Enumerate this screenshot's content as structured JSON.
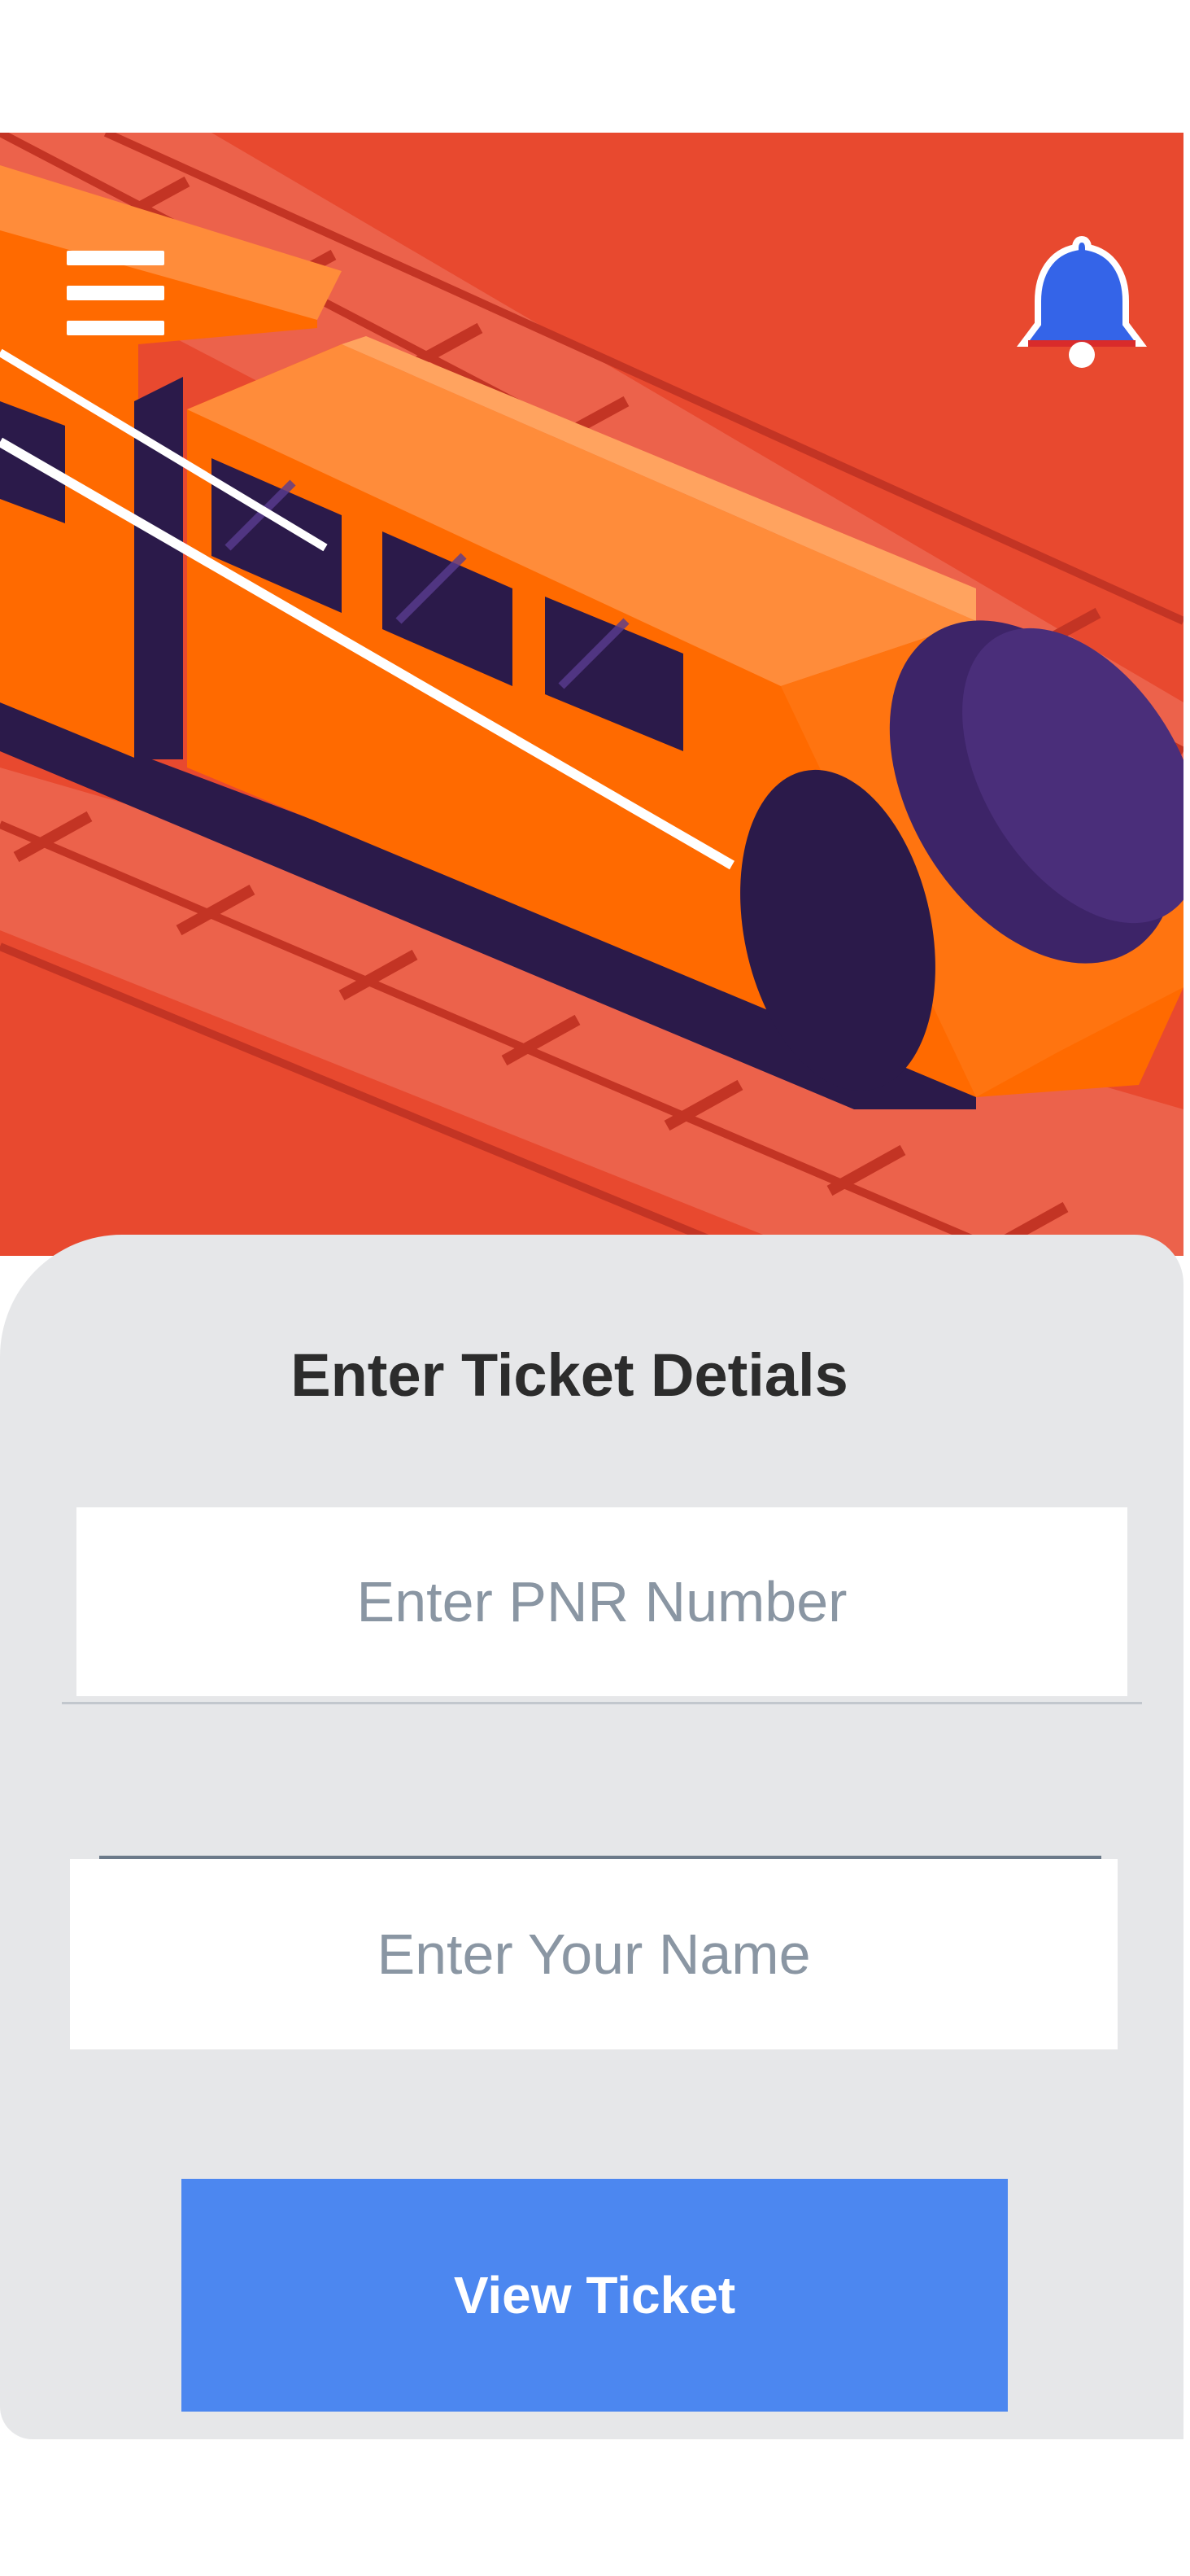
{
  "header": {
    "menu_icon": "hamburger-menu-icon",
    "notification_icon": "bell-icon"
  },
  "hero": {
    "illustration": "train-illustration",
    "colors": {
      "background": "#e8492f",
      "train_body": "#ff6a00",
      "train_top": "#ff8c3a",
      "windows": "#2b1a4a",
      "rails": "#c9382a"
    }
  },
  "form": {
    "title": "Enter Ticket Detials",
    "pnr_placeholder": "Enter PNR Number",
    "name_placeholder": "Enter Your Name",
    "submit_label": "View Ticket"
  },
  "colors": {
    "card_background": "#e6e7e9",
    "button": "#4c87f0",
    "bell": "#3464e8"
  }
}
